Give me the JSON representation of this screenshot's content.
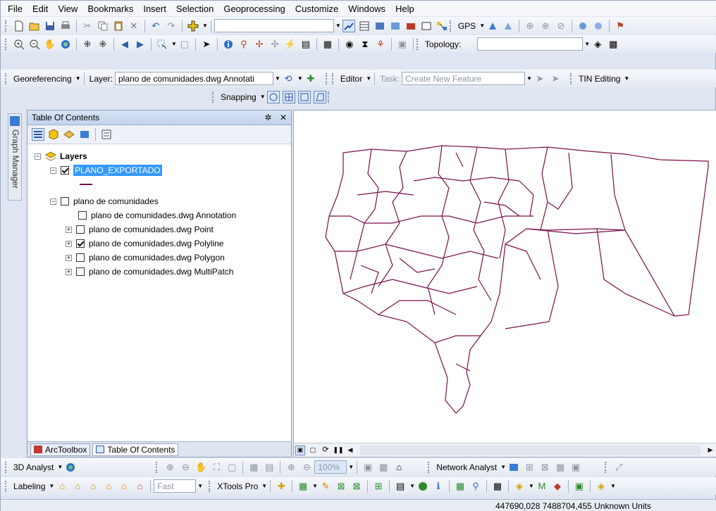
{
  "menu": [
    "File",
    "Edit",
    "View",
    "Bookmarks",
    "Insert",
    "Selection",
    "Geoprocessing",
    "Customize",
    "Windows",
    "Help"
  ],
  "toolbar1": {
    "gps_label": "GPS"
  },
  "toolbar2": {
    "topology_label": "Topology:"
  },
  "toolbar3": {
    "georef_label": "Georeferencing",
    "layer_label": "Layer:",
    "layer_value": "plano de comunidades.dwg Annotati",
    "editor_label": "Editor",
    "task_label": "Task:",
    "task_value": "Create New Feature",
    "tin_label": "TIN Editing"
  },
  "toolbar4": {
    "snapping_label": "Snapping"
  },
  "sidebar": {
    "graph_manager": "Graph Manager"
  },
  "toc": {
    "title": "Table Of Contents",
    "pin": "✲",
    "close": "✕",
    "layers_label": "Layers",
    "items": [
      {
        "label": "PLANO_EXPORTADO",
        "checked": true,
        "selected": true
      },
      {
        "label": "plano de comunidades",
        "checked": false
      },
      {
        "label": "plano de comunidades.dwg Annotation",
        "checked": false
      },
      {
        "label": "plano de comunidades.dwg Point",
        "checked": false
      },
      {
        "label": "plano de comunidades.dwg Polyline",
        "checked": true
      },
      {
        "label": "plano de comunidades.dwg Polygon",
        "checked": false
      },
      {
        "label": "plano de comunidades.dwg MultiPatch",
        "checked": false
      }
    ],
    "tabs": [
      "ArcToolbox",
      "Table Of Contents"
    ]
  },
  "bottom1": {
    "analyst_label": "3D Analyst",
    "zoom_value": "100%",
    "network_label": "Network Analyst"
  },
  "bottom2": {
    "labeling_label": "Labeling",
    "fast_value": "Fast",
    "xtools_label": "XTools Pro"
  },
  "status": {
    "coords": "447690,028  7488704,455 Unknown Units"
  },
  "colors": {
    "polyline": "#7a0f4a",
    "selection": "#3399ff"
  }
}
